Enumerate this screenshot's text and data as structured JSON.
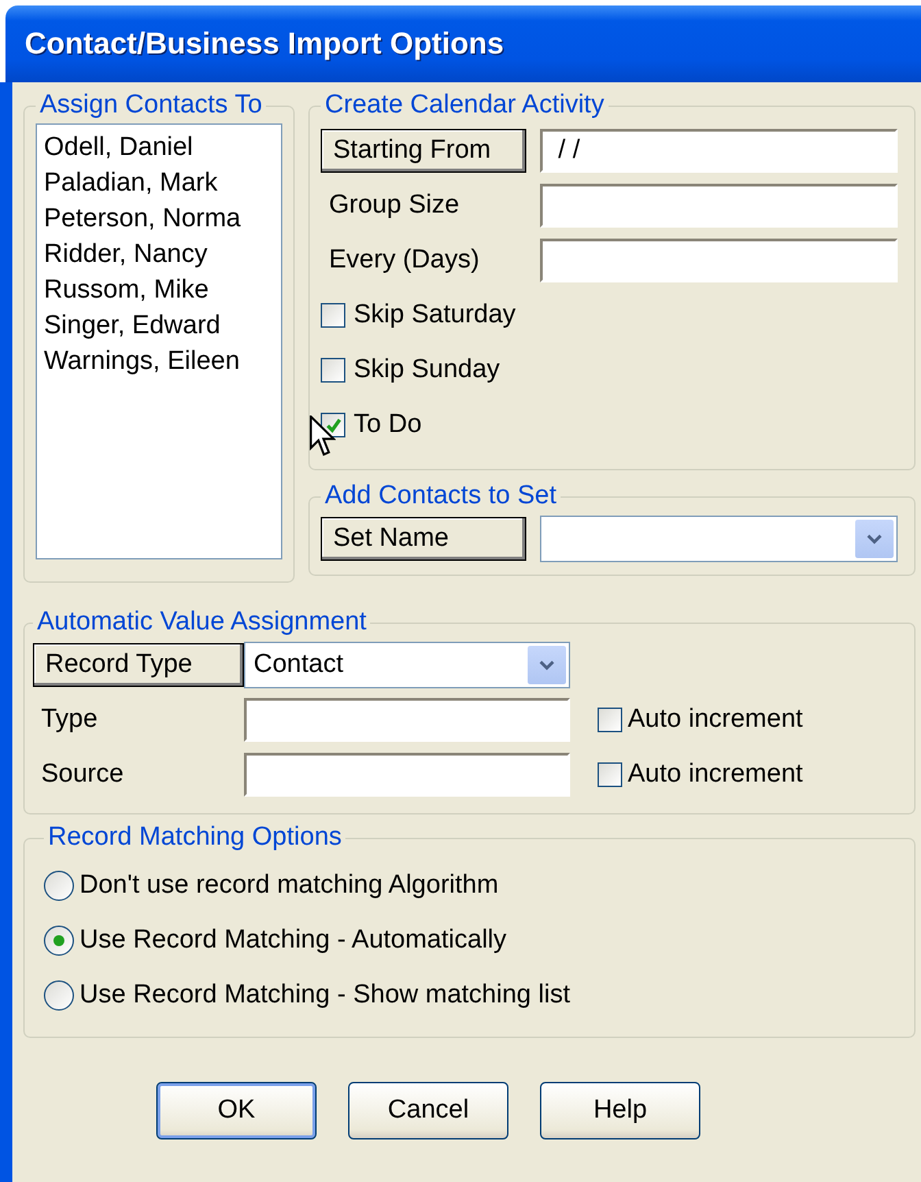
{
  "window": {
    "title": "Contact/Business Import Options"
  },
  "assign_contacts": {
    "legend": "Assign Contacts To",
    "contacts": [
      "Odell, Daniel",
      "Paladian, Mark",
      "Peterson, Norma",
      "Ridder, Nancy",
      "Russom, Mike",
      "Singer, Edward",
      "Warnings, Eileen"
    ]
  },
  "calendar_activity": {
    "legend": "Create Calendar Activity",
    "starting_from": {
      "button": "Starting From",
      "value": " / /"
    },
    "fields": [
      {
        "label": "Group Size"
      },
      {
        "label": "Every (Days)"
      }
    ],
    "checkboxes": [
      {
        "label": "Skip Saturday",
        "checked": false
      },
      {
        "label": "Skip Sunday",
        "checked": false
      },
      {
        "label": "To Do",
        "checked": true
      }
    ]
  },
  "contact_set": {
    "legend": "Add Contacts to Set",
    "button": "Set Name"
  },
  "auto_value": {
    "legend": "Automatic Value Assignment",
    "record_type": {
      "button": "Record Type",
      "value": "Contact"
    },
    "fields": [
      {
        "label": "Type",
        "auto_increment": {
          "label": "Auto increment",
          "checked": false
        }
      },
      {
        "label": "Source",
        "auto_increment": {
          "label": "Auto increment",
          "checked": false
        }
      }
    ]
  },
  "record_matching": {
    "legend": "Record Matching Options",
    "options": [
      {
        "label": "Don't use record matching Algorithm",
        "selected": false
      },
      {
        "label": "Use Record Matching - Automatically",
        "selected": true
      },
      {
        "label": "Use Record Matching - Show matching list",
        "selected": false
      }
    ]
  },
  "buttons": [
    {
      "label": "OK",
      "default": true
    },
    {
      "label": "Cancel",
      "default": false
    },
    {
      "label": "Help",
      "default": false
    }
  ]
}
